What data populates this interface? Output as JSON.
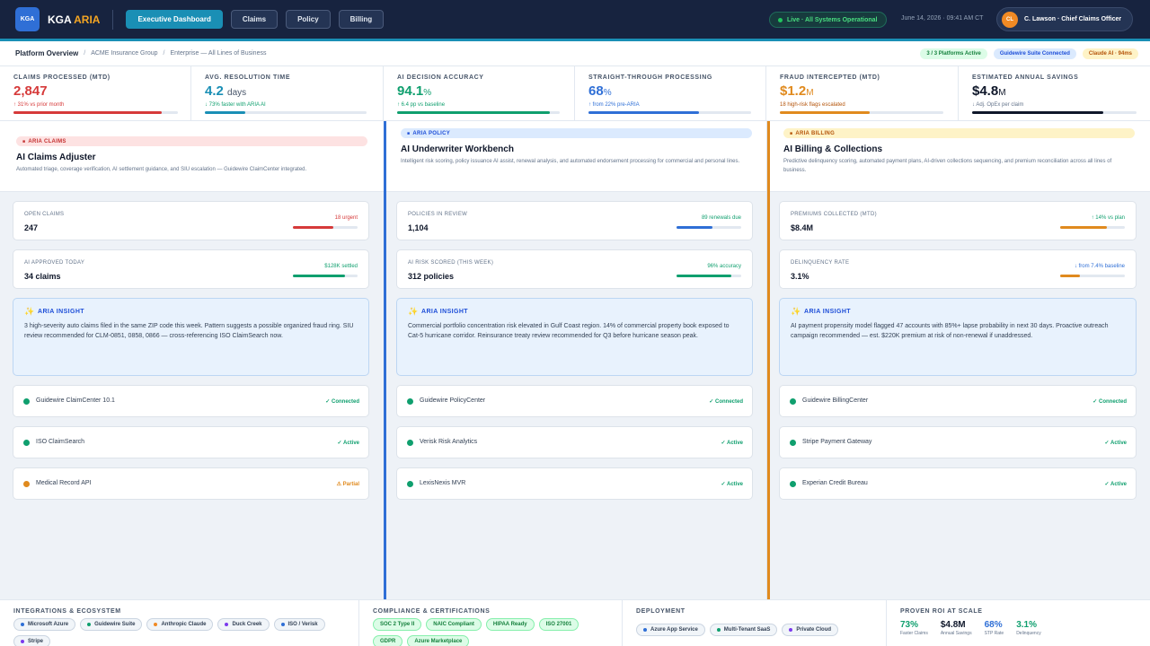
{
  "app": {
    "logo": "KGA",
    "brand_main": "KGA",
    "brand_accent": "ARIA"
  },
  "nav": [
    {
      "label": "Executive Dashboard",
      "active": true
    },
    {
      "label": "Claims",
      "active": false
    },
    {
      "label": "Policy",
      "active": false
    },
    {
      "label": "Billing",
      "active": false
    }
  ],
  "status": "Live · All Systems Operational",
  "datetime": "June 14, 2026 · 09:41 AM CT",
  "user": {
    "initials": "CL",
    "name": "C. Lawson · Chief Claims Officer"
  },
  "breadcrumb": {
    "current": "Platform Overview",
    "items": [
      "ACME Insurance Group",
      "Enterprise — All Lines of Business"
    ]
  },
  "tags": [
    "3 / 3 Platforms Active",
    "Guidewire Suite Connected",
    "Claude AI · 94ms"
  ],
  "kpis": [
    {
      "label": "CLAIMS PROCESSED (MTD)",
      "value": "2,847",
      "unit": "",
      "sub": "↑ 31% vs prior month",
      "color": "#d63a3a",
      "fill": 0.9
    },
    {
      "label": "AVG. RESOLUTION TIME",
      "value": "4.2",
      "unit": "days",
      "sub": "↓ 73% faster with ARIA AI",
      "color": "#1a8fb5",
      "fill": 0.25
    },
    {
      "label": "AI DECISION ACCURACY",
      "value": "94.1",
      "unit": "%",
      "sub": "↑ 6.4 pp vs baseline",
      "color": "#0f9f6e",
      "fill": 0.94
    },
    {
      "label": "STRAIGHT-THROUGH PROCESSING",
      "value": "68",
      "unit": "%",
      "sub": "↑ from 22% pre-ARIA",
      "color": "#2f6fd6",
      "fill": 0.68
    },
    {
      "label": "FRAUD INTERCEPTED (MTD)",
      "value": "$1.2",
      "unit": "M",
      "sub": "18 high-risk flags escalated",
      "color": "#e08a1e",
      "fill": 0.55
    },
    {
      "label": "ESTIMATED ANNUAL SAVINGS",
      "value": "$4.8",
      "unit": "M",
      "sub": "↓ Adj. OpEx per claim",
      "color": "#0f172a",
      "fill": 0.8
    }
  ],
  "sections": [
    {
      "badge": "ARIA CLAIMS",
      "title": "AI Claims Adjuster",
      "desc": "Automated triage, coverage verification, AI settlement guidance, and SIU escalation — Guidewire ClaimCenter integrated.",
      "stats": [
        {
          "label": "OPEN CLAIMS",
          "value": "247",
          "note": "18 urgent",
          "fill": 0.62
        },
        {
          "label": "AI APPROVED TODAY",
          "value": "34 claims",
          "note": "$128K settled",
          "fill": 0.8
        }
      ],
      "insight_title": "ARIA INSIGHT",
      "insight": "3 high-severity auto claims filed in the same ZIP code this week. Pattern suggests a possible organized fraud ring. SIU review recommended for CLM-0851, 0858, 0866 — cross-referencing ISO ClaimSearch now.",
      "integrations": [
        {
          "name": "Guidewire ClaimCenter 10.1",
          "status": "✓ Connected",
          "state": "ok"
        },
        {
          "name": "ISO ClaimSearch",
          "status": "✓ Active",
          "state": "ok"
        },
        {
          "name": "Medical Record API",
          "status": "⚠ Partial",
          "state": "warn"
        }
      ]
    },
    {
      "badge": "ARIA POLICY",
      "title": "AI Underwriter Workbench",
      "desc": "Intelligent risk scoring, policy issuance AI assist, renewal analysis, and automated endorsement processing for commercial and personal lines.",
      "stats": [
        {
          "label": "POLICIES IN REVIEW",
          "value": "1,104",
          "note": "89 renewals due",
          "fill": 0.55
        },
        {
          "label": "AI RISK SCORED (THIS WEEK)",
          "value": "312 policies",
          "note": "96% accuracy",
          "fill": 0.85
        }
      ],
      "insight_title": "ARIA INSIGHT",
      "insight": "Commercial portfolio concentration risk elevated in Gulf Coast region. 14% of commercial property book exposed to Cat-5 hurricane corridor. Reinsurance treaty review recommended for Q3 before hurricane season peak.",
      "integrations": [
        {
          "name": "Guidewire PolicyCenter",
          "status": "✓ Connected",
          "state": "ok"
        },
        {
          "name": "Verisk Risk Analytics",
          "status": "✓ Active",
          "state": "ok"
        },
        {
          "name": "LexisNexis MVR",
          "status": "✓ Active",
          "state": "ok"
        }
      ]
    },
    {
      "badge": "ARIA BILLING",
      "title": "AI Billing & Collections",
      "desc": "Predictive delinquency scoring, automated payment plans, AI-driven collections sequencing, and premium reconciliation across all lines of business.",
      "stats": [
        {
          "label": "PREMIUMS COLLECTED (MTD)",
          "value": "$8.4M",
          "note": "↑ 14% vs plan",
          "fill": 0.72
        },
        {
          "label": "DELINQUENCY RATE",
          "value": "3.1%",
          "note": "↓ from 7.4% baseline",
          "fill": 0.3
        }
      ],
      "insight_title": "ARIA INSIGHT",
      "insight": "AI payment propensity model flagged 47 accounts with 85%+ lapse probability in next 30 days. Proactive outreach campaign recommended — est. $220K premium at risk of non-renewal if unaddressed.",
      "integrations": [
        {
          "name": "Guidewire BillingCenter",
          "status": "✓ Connected",
          "state": "ok"
        },
        {
          "name": "Stripe Payment Gateway",
          "status": "✓ Active",
          "state": "ok"
        },
        {
          "name": "Experian Credit Bureau",
          "status": "✓ Active",
          "state": "ok"
        }
      ]
    }
  ],
  "footer": {
    "integrations_title": "INTEGRATIONS & ECOSYSTEM",
    "integrations": [
      {
        "label": "Microsoft Azure",
        "color": "#2f6fd6"
      },
      {
        "label": "Guidewire Suite",
        "color": "#0f9f6e"
      },
      {
        "label": "Anthropic Claude",
        "color": "#f08a24"
      },
      {
        "label": "Duck Creek",
        "color": "#7c3aed"
      },
      {
        "label": "ISO / Verisk",
        "color": "#2f6fd6"
      },
      {
        "label": "Stripe",
        "color": "#7c3aed"
      }
    ],
    "compliance_title": "COMPLIANCE & CERTIFICATIONS",
    "compliance": [
      "SOC 2 Type II",
      "NAIC Compliant",
      "HIPAA Ready",
      "ISO 27001",
      "GDPR",
      "Azure Marketplace"
    ],
    "deployment_title": "DEPLOYMENT",
    "deployment": [
      {
        "label": "Azure App Service",
        "color": "#2f6fd6"
      },
      {
        "label": "Multi-Tenant SaaS",
        "color": "#0f9f6e"
      },
      {
        "label": "Private Cloud",
        "color": "#7c3aed"
      }
    ],
    "roi_title": "PROVEN ROI AT SCALE",
    "roi": [
      {
        "value": "73%",
        "label": "Faster Claims",
        "color": "#0f9f6e"
      },
      {
        "value": "$4.8M",
        "label": "Annual Savings",
        "color": "#0f172a"
      },
      {
        "value": "68%",
        "label": "STP Rate",
        "color": "#2f6fd6"
      },
      {
        "value": "3.1%",
        "label": "Delinquency",
        "color": "#0f9f6e"
      }
    ]
  },
  "colors": {
    "claims": "#d63a3a",
    "policy": "#2f6fd6",
    "billing": "#e08a1e",
    "ok": "#0f9f6e",
    "warn": "#e08a1e"
  }
}
